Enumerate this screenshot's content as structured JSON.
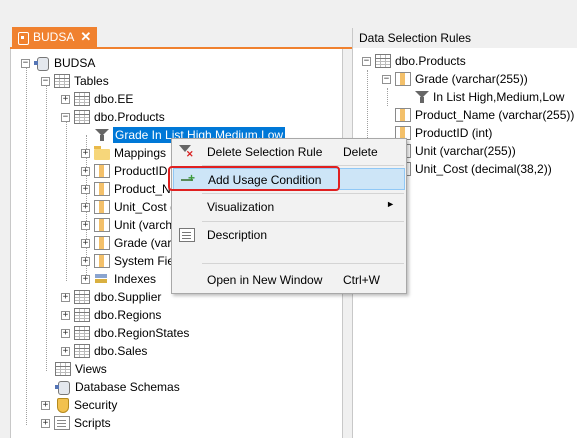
{
  "tab": {
    "title": "BUDSA",
    "close": "✕"
  },
  "tree": {
    "root": "BUDSA",
    "tables": "Tables",
    "ee": "dbo.EE",
    "products": "dbo.Products",
    "filter_node": "Grade In List High,Medium,Low",
    "mappings": "Mappings",
    "productid": "ProductID (",
    "product_name": "Product_Na",
    "unit_cost": "Unit_Cost (c",
    "unit": "Unit (varcha",
    "grade": "Grade (varc",
    "system_fields": "System Field",
    "indexes": "Indexes",
    "supplier": "dbo.Supplier",
    "regions": "dbo.Regions",
    "regionstates": "dbo.RegionStates",
    "sales": "dbo.Sales",
    "views": "Views",
    "database_schemas": "Database Schemas",
    "security": "Security",
    "scripts": "Scripts"
  },
  "context_menu": {
    "delete_label": "Delete Selection Rule",
    "delete_shortcut": "Delete",
    "add_usage_label": "Add Usage Condition",
    "visualization_label": "Visualization",
    "visualization_arrow": "►",
    "description_label": "Description",
    "open_window_label": "Open in New Window",
    "open_window_shortcut": "Ctrl+W"
  },
  "rules_panel": {
    "header": "Data Selection Rules",
    "table": "dbo.Products",
    "grade": "Grade (varchar(255))",
    "condition": "In List High,Medium,Low",
    "product_name": "Product_Name (varchar(255))",
    "productid": "ProductID (int)",
    "unit": "Unit (varchar(255))",
    "unit_cost": "Unit_Cost (decimal(38,2))"
  },
  "colors": {
    "tab_accent": "#f0812f",
    "selection": "#0078d7",
    "highlight_border": "#e02020"
  }
}
